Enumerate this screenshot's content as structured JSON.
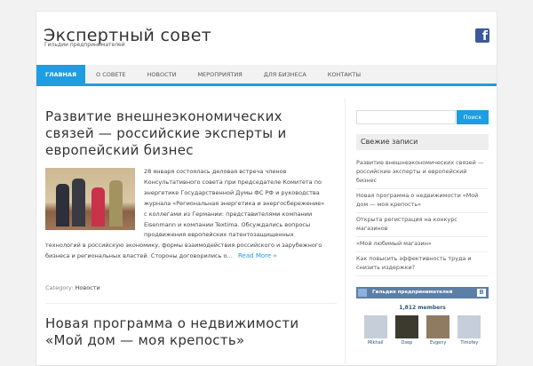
{
  "site": {
    "title": "Экспертный совет",
    "tagline": "Гильдии предпринимателей"
  },
  "nav": [
    "Главная",
    "О совете",
    "Новости",
    "Мероприятия",
    "Для бизнеса",
    "Контакты"
  ],
  "posts": [
    {
      "title": "Развитие внешнеэкономических связей — российские эксперты и европейский бизнес",
      "excerpt": "28 января состоялась деловая встреча членов Консультативного совета при председателе Комитета по энергетике Государственной Думы ФС РФ и руководства журнала «Региональная энергетика и энергосбережение» с коллегами из Германии: представителями компании Eisenmann и компании Textima.  Обсуждались вопросы продвижения европейских патентозащищенных технологий в российскую экономику, формы взаимодействия российского и зарубежного бизнеса и региональных властей. Стороны договорились о…",
      "read_more": "Read More »",
      "category_label": "Category:",
      "category": "Новости"
    },
    {
      "title": "Новая программа о недвижимости «Мой дом — моя крепость»"
    }
  ],
  "sidebar": {
    "search_button": "Поиск",
    "search_placeholder": "",
    "recent_title": "Свежие записи",
    "recent": [
      "Развитие внешнеэкономических связей — российские эксперты и европейский бизнес",
      "Новая программа о недвижимости «Мой дом — моя крепость»",
      "Открыта регистрация на конкурс магазинов",
      "«Мой любимый магазин»",
      "Как повысить эффективность труда и снизить издержки?"
    ],
    "vk": {
      "title": "Гильдия предпринимателей",
      "members": "1,812 members",
      "logo": "B",
      "people": [
        "Mikhail",
        "Озер",
        "Evgeny",
        "Timofey"
      ]
    }
  }
}
